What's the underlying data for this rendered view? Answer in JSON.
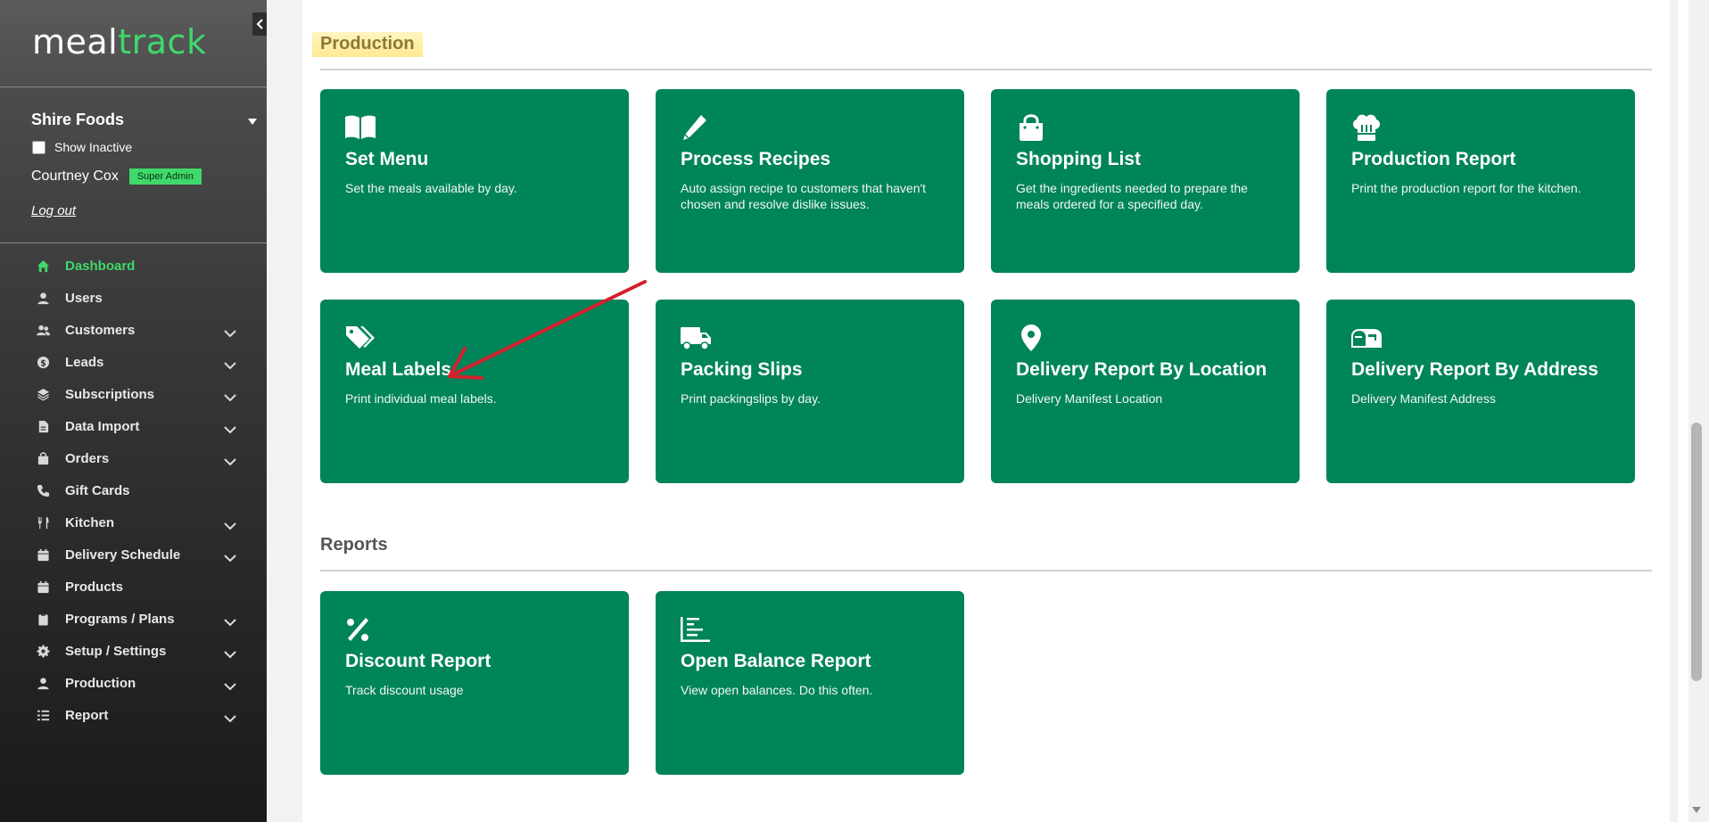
{
  "brand": {
    "part1": "meal",
    "part2": "track"
  },
  "sidebar": {
    "org_name": "Shire Foods",
    "show_inactive_label": "Show Inactive",
    "user_name": "Courtney Cox",
    "user_role": "Super Admin",
    "logout_label": "Log out",
    "items": [
      {
        "label": "Dashboard",
        "icon": "home-icon",
        "active": true,
        "has_submenu": false
      },
      {
        "label": "Users",
        "icon": "user-icon",
        "active": false,
        "has_submenu": false
      },
      {
        "label": "Customers",
        "icon": "users-icon",
        "active": false,
        "has_submenu": true
      },
      {
        "label": "Leads",
        "icon": "dollar-icon",
        "active": false,
        "has_submenu": true
      },
      {
        "label": "Subscriptions",
        "icon": "layers-icon",
        "active": false,
        "has_submenu": true
      },
      {
        "label": "Data Import",
        "icon": "file-icon",
        "active": false,
        "has_submenu": true
      },
      {
        "label": "Orders",
        "icon": "bag-icon",
        "active": false,
        "has_submenu": true
      },
      {
        "label": "Gift Cards",
        "icon": "phone-icon",
        "active": false,
        "has_submenu": false
      },
      {
        "label": "Kitchen",
        "icon": "utensils-icon",
        "active": false,
        "has_submenu": true
      },
      {
        "label": "Delivery Schedule",
        "icon": "calendar-icon",
        "active": false,
        "has_submenu": true
      },
      {
        "label": "Products",
        "icon": "calendar-icon",
        "active": false,
        "has_submenu": false
      },
      {
        "label": "Programs / Plans",
        "icon": "clipboard-icon",
        "active": false,
        "has_submenu": true
      },
      {
        "label": "Setup / Settings",
        "icon": "gear-icon",
        "active": false,
        "has_submenu": true
      },
      {
        "label": "Production",
        "icon": "user-icon",
        "active": false,
        "has_submenu": true
      },
      {
        "label": "Report",
        "icon": "list-icon",
        "active": false,
        "has_submenu": true
      }
    ]
  },
  "production": {
    "title": "Production",
    "cards": [
      {
        "title": "Set Menu",
        "desc": "Set the meals available by day.",
        "icon": "book-icon"
      },
      {
        "title": "Process Recipes",
        "desc": "Auto assign recipe to customers that haven't chosen and resolve dislike issues.",
        "icon": "pen-icon"
      },
      {
        "title": "Shopping List",
        "desc": "Get the ingredients needed to prepare the meals ordered for a specified day.",
        "icon": "shopping-bag-icon"
      },
      {
        "title": "Production Report",
        "desc": "Print the production report for the kitchen.",
        "icon": "chef-hat-icon"
      },
      {
        "title": "Meal Labels",
        "desc": "Print individual meal labels.",
        "icon": "tags-icon"
      },
      {
        "title": "Packing Slips",
        "desc": "Print packingslips by day.",
        "icon": "truck-icon"
      },
      {
        "title": "Delivery Report By Location",
        "desc": "Delivery Manifest Location",
        "icon": "map-pin-icon"
      },
      {
        "title": "Delivery Report By Address",
        "desc": "Delivery Manifest Address",
        "icon": "mailbox-icon"
      }
    ]
  },
  "reports": {
    "title": "Reports",
    "cards": [
      {
        "title": "Discount Report",
        "desc": "Track discount usage",
        "icon": "percent-icon"
      },
      {
        "title": "Open Balance Report",
        "desc": "View open balances. Do this often.",
        "icon": "chart-icon"
      }
    ]
  },
  "colors": {
    "card_green": "#00845a",
    "accent_green": "#3fd96a",
    "highlight_yellow": "#ffe26e",
    "annotation_red": "#d4202c"
  }
}
